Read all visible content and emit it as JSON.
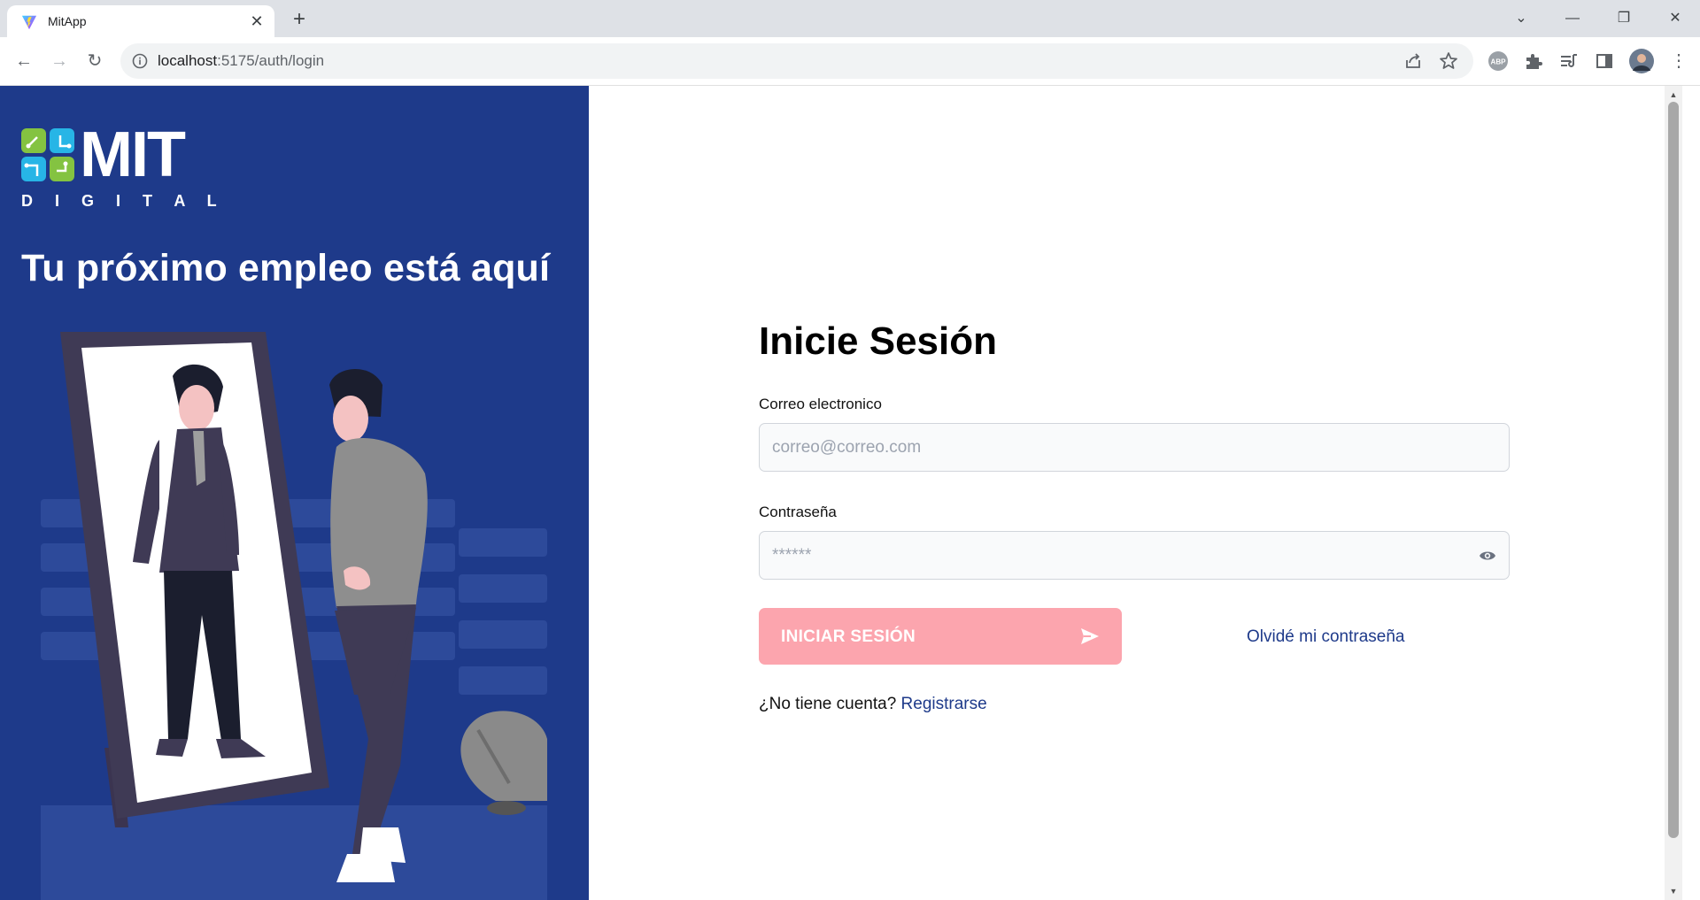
{
  "browser": {
    "tab_title": "MitApp",
    "url_host": "localhost",
    "url_rest": ":5175/auth/login",
    "extension_badge": "ABP"
  },
  "brand": {
    "logo_text": "MIT",
    "logo_subtext": "D I G I T A L"
  },
  "hero": {
    "title": "Tu próximo empleo está aquí"
  },
  "login": {
    "title": "Inicie Sesión",
    "email_label": "Correo electronico",
    "email_placeholder": "correo@correo.com",
    "password_label": "Contraseña",
    "password_placeholder": "******",
    "submit_label": "INICIAR SESIÓN",
    "forgot_label": "Olvidé mi contraseña",
    "no_account_text": "¿No tiene cuenta?",
    "register_label": "Registrarse"
  },
  "colors": {
    "panel_blue": "#1e3a8a",
    "button_pink": "#fca5ae",
    "link_blue": "#1e3a8a"
  }
}
